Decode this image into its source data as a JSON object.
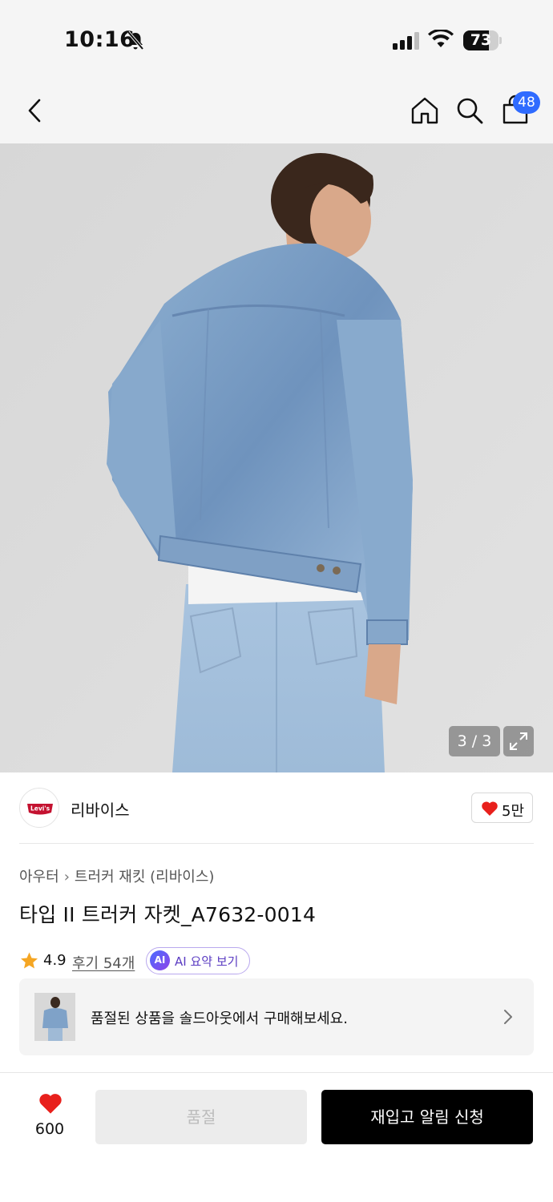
{
  "status_bar": {
    "time": "10:16",
    "battery": "73",
    "battery_level": 0.73
  },
  "nav": {
    "back_icon": "chevron-left-icon",
    "home_icon": "home-icon",
    "search_icon": "search-icon",
    "cart_icon": "shopping-bag-icon",
    "cart_badge": "48"
  },
  "gallery": {
    "counter": "3 / 3",
    "expand_icon": "expand-icon"
  },
  "brand": {
    "logo_text": "Levi's",
    "name": "리바이스",
    "like_count": "5만",
    "like_icon": "heart-icon"
  },
  "breadcrumb": {
    "items": [
      "아우터",
      "트러커 재킷 (리바이스)"
    ]
  },
  "product": {
    "title": "타입 II 트러커 자켓_A7632-0014",
    "rating": "4.9",
    "reviews": "후기 54개",
    "ai_badge": "AI",
    "ai_summary": "AI 요약 보기"
  },
  "soldout_banner": {
    "text": "품절된 상품을 솔드아웃에서 구매해보세요."
  },
  "bottom_bar": {
    "wish_count": "600",
    "soldout_label": "품절",
    "restock_label": "재입고 알림 신청"
  },
  "colors": {
    "cart_badge": "#2f6bff",
    "heart": "#e8201c",
    "star": "#f5a623",
    "restock_button": "#000000"
  }
}
